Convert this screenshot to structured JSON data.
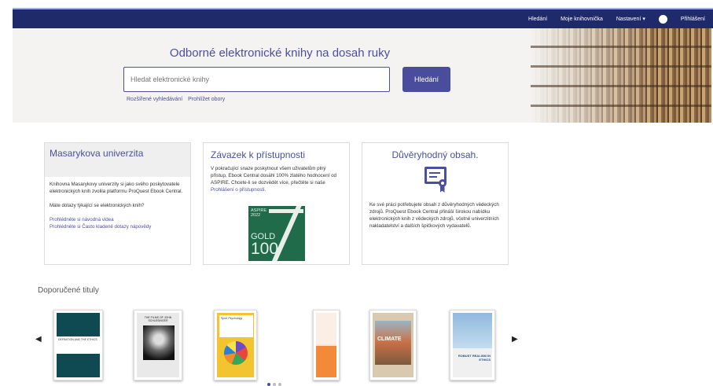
{
  "nav": {
    "links": [
      "Hledání",
      "Moje knihovnička",
      "Nastavení ▾",
      "Přihlášení"
    ],
    "help": "?"
  },
  "hero": {
    "title": "Odborné elektronické knihy na dosah ruky",
    "search_placeholder": "Hledat elektronické knihy",
    "search_button": "Hledání",
    "links": [
      "Rozšířené vyhledávání",
      "Prohlížet obory"
    ]
  },
  "card1": {
    "title": "Masarykova univerzita",
    "text1": "Knihovna Masarykovy univerzity si jako svého poskytovatele elektronických knih zvolila platformu ProQuest Ebook Central.",
    "text2": "Máte dotazy týkající se elektronických knih?",
    "link1": "Prohlédněte si návodná videa",
    "link2": "Prohlédněte si Často kladené dotazy nápovědy"
  },
  "card2": {
    "title": "Závazek k přístupnosti",
    "text": "V pokračující snaze poskytnout všem uživatelům plný přístup, Ebook Central dosáhl 100% zlatého hodnocení od ASPIRE. Chcete-li se dozvědět více, přečtěte si naše",
    "link": "Prohlášení o přístupnosti.",
    "badge": {
      "aspire": "ASPIRE",
      "year": "2022",
      "gold": "GOLD",
      "hundred": "100"
    }
  },
  "card3": {
    "title": "Důvěryhodný obsah.",
    "text": "Ke své práci potřebujete obsah z důvěryhodných vědeckých zdrojů. ProQuest Ebook Central přináší širokou nabídku elektronických knih z vědeckých zdrojů, včetně univerzitních nakladatelství a dalších špičkových vydavatelů."
  },
  "recommended": {
    "title": "Doporučené tituly",
    "books": [
      {
        "label": "DEFINITION AND THE ETHICS"
      },
      {
        "label": "THE FILMS OF JOHN SCHLESINGER"
      },
      {
        "label": "Sport Psychology"
      },
      {
        "label": ""
      },
      {
        "label": "CLIMATE"
      },
      {
        "label": "ROBUST REALISM IN ETHICS"
      }
    ]
  },
  "colors": {
    "navbar": "#1f2a6b",
    "accent": "#4a4f9e",
    "button": "#4a4c9c"
  }
}
